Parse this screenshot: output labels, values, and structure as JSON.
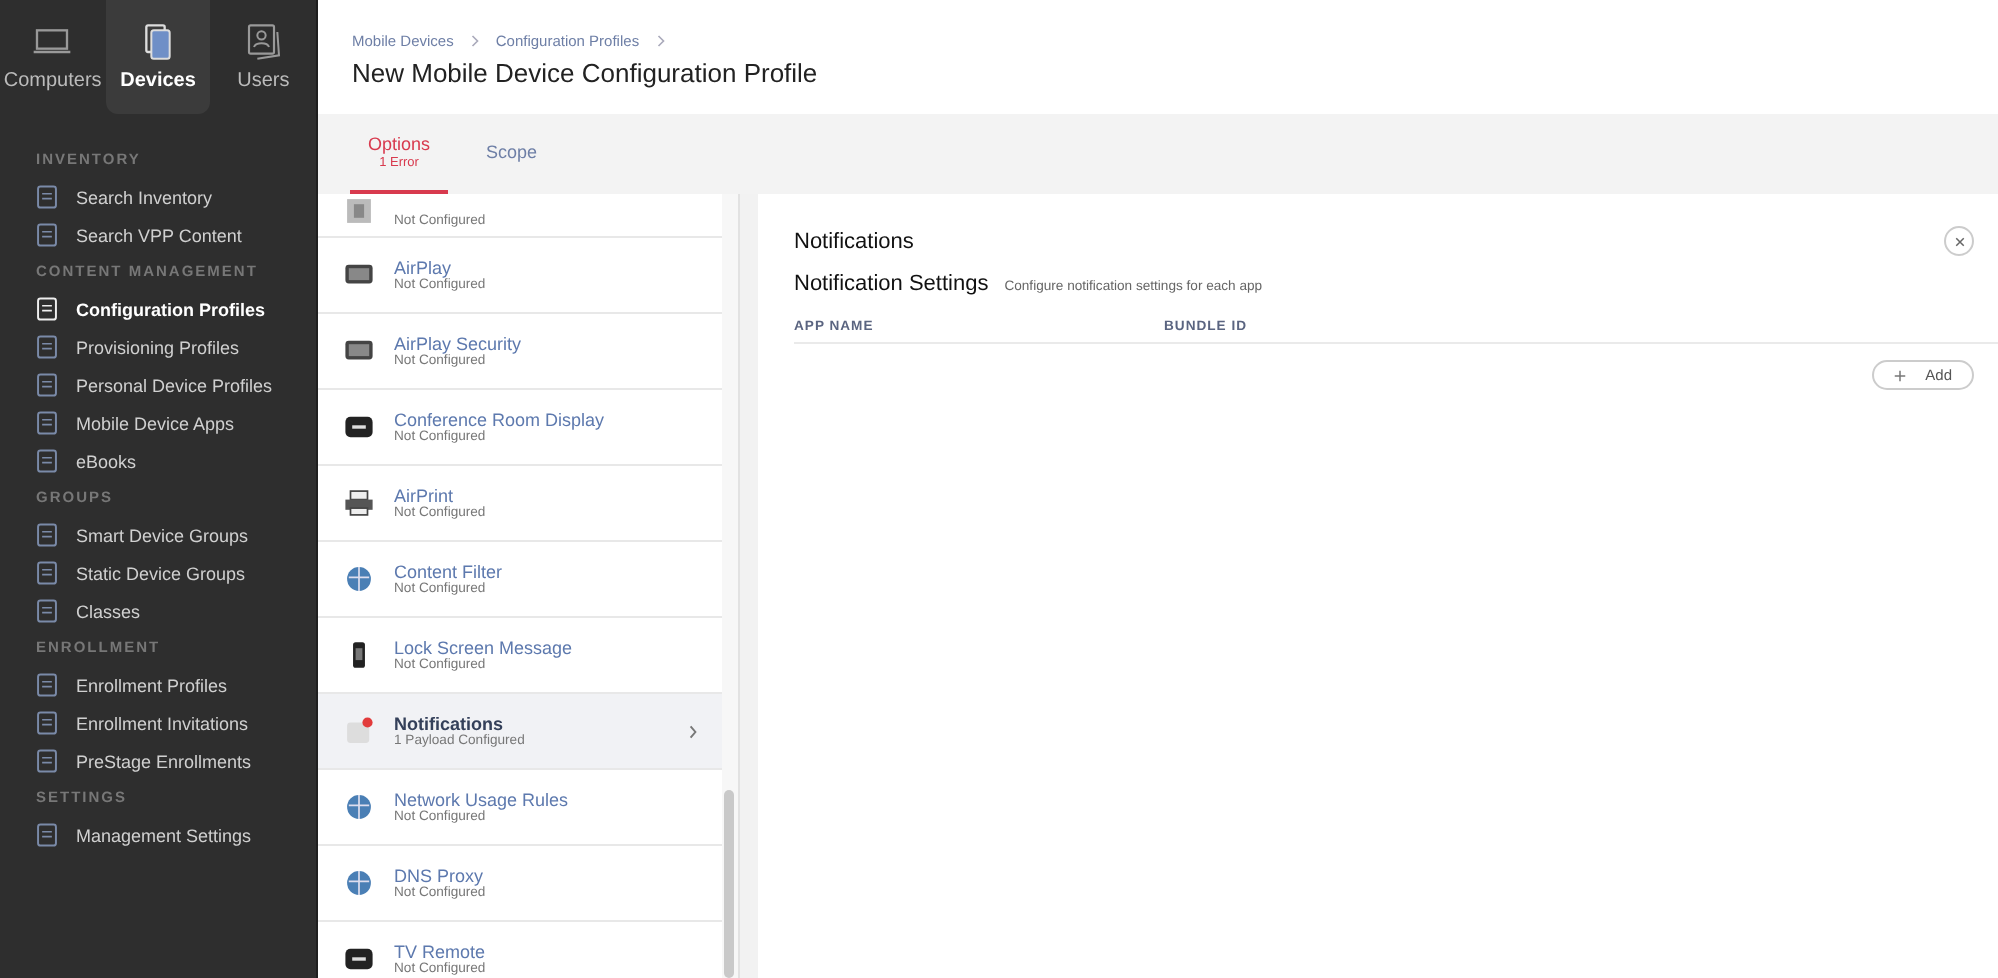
{
  "top_nav": [
    {
      "label": "Computers",
      "selected": false
    },
    {
      "label": "Devices",
      "selected": true
    },
    {
      "label": "Users",
      "selected": false
    }
  ],
  "sidebar": {
    "sections": [
      {
        "title": "INVENTORY",
        "items": [
          {
            "label": "Search Inventory",
            "selected": false
          },
          {
            "label": "Search VPP Content",
            "selected": false
          }
        ]
      },
      {
        "title": "CONTENT MANAGEMENT",
        "items": [
          {
            "label": "Configuration Profiles",
            "selected": true
          },
          {
            "label": "Provisioning Profiles",
            "selected": false
          },
          {
            "label": "Personal Device Profiles",
            "selected": false
          },
          {
            "label": "Mobile Device Apps",
            "selected": false
          },
          {
            "label": "eBooks",
            "selected": false
          }
        ]
      },
      {
        "title": "GROUPS",
        "items": [
          {
            "label": "Smart Device Groups",
            "selected": false
          },
          {
            "label": "Static Device Groups",
            "selected": false
          },
          {
            "label": "Classes",
            "selected": false
          }
        ]
      },
      {
        "title": "ENROLLMENT",
        "items": [
          {
            "label": "Enrollment Profiles",
            "selected": false
          },
          {
            "label": "Enrollment Invitations",
            "selected": false
          },
          {
            "label": "PreStage Enrollments",
            "selected": false
          }
        ]
      },
      {
        "title": "SETTINGS",
        "items": [
          {
            "label": "Management Settings",
            "selected": false
          }
        ]
      }
    ]
  },
  "breadcrumbs": [
    "Mobile Devices",
    "Configuration Profiles"
  ],
  "page_title": "New Mobile Device Configuration Profile",
  "tabs": [
    {
      "label": "Options",
      "error": "1 Error",
      "selected": true
    },
    {
      "label": "Scope",
      "selected": false
    }
  ],
  "payloads": [
    {
      "status": "Not Configured",
      "selected": false
    },
    {
      "name": "AirPlay",
      "status": "Not Configured",
      "selected": false
    },
    {
      "name": "AirPlay Security",
      "status": "Not Configured",
      "selected": false
    },
    {
      "name": "Conference Room Display",
      "status": "Not Configured",
      "selected": false
    },
    {
      "name": "AirPrint",
      "status": "Not Configured",
      "selected": false
    },
    {
      "name": "Content Filter",
      "status": "Not Configured",
      "selected": false
    },
    {
      "name": "Lock Screen Message",
      "status": "Not Configured",
      "selected": false
    },
    {
      "name": "Notifications",
      "status": "1 Payload Configured",
      "selected": true
    },
    {
      "name": "Network Usage Rules",
      "status": "Not Configured",
      "selected": false
    },
    {
      "name": "DNS Proxy",
      "status": "Not Configured",
      "selected": false
    },
    {
      "name": "TV Remote",
      "status": "Not Configured",
      "selected": false
    }
  ],
  "panel": {
    "title": "Notifications",
    "section_title": "Notification Settings",
    "section_hint": "Configure notification settings for each app",
    "columns": [
      "APP NAME",
      "BUNDLE ID"
    ],
    "add_button": "Add"
  }
}
